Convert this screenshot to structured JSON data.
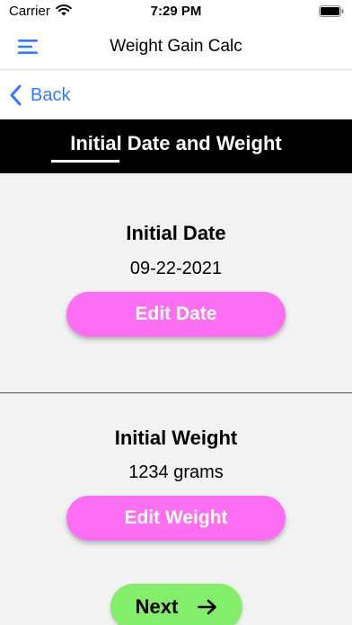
{
  "status_bar": {
    "carrier": "Carrier",
    "time": "7:29 PM"
  },
  "nav": {
    "title": "Weight Gain Calc",
    "menu_icon": "hamburger-menu-icon"
  },
  "back": {
    "label": "Back",
    "icon": "chevron-left-icon",
    "color": "#2f7cf6"
  },
  "section": {
    "title": "Initial Date and Weight"
  },
  "date_field": {
    "label": "Initial Date",
    "value": "09-22-2021",
    "button_label": "Edit Date"
  },
  "weight_field": {
    "label": "Initial Weight",
    "value": "1234 grams",
    "button_label": "Edit Weight"
  },
  "next": {
    "label": "Next",
    "icon": "arrow-right-icon"
  },
  "colors": {
    "edit_button": "#fc6ff3",
    "next_button": "#85ed6c",
    "accent": "#2f7cf6",
    "header_bg": "#000000",
    "page_bg": "#f2f2f2"
  }
}
